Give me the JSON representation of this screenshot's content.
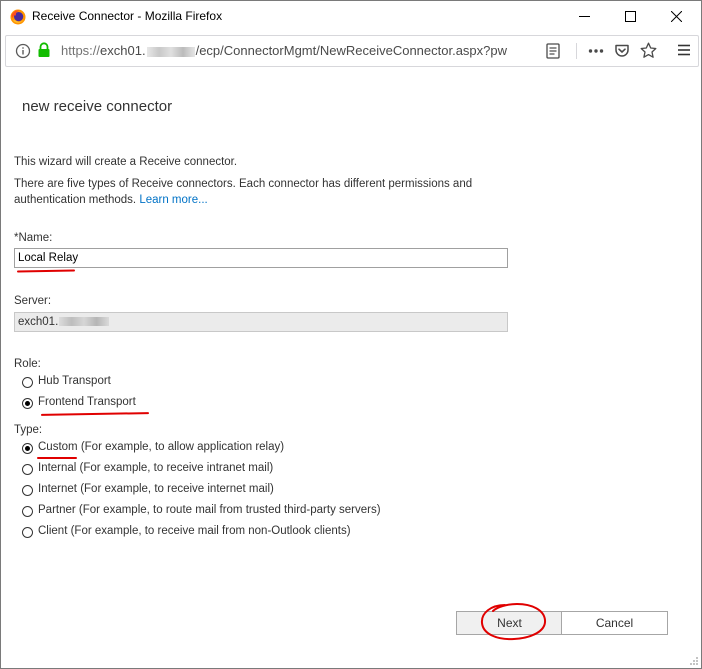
{
  "window": {
    "title": "Receive Connector - Mozilla Firefox"
  },
  "urlbar": {
    "scheme": "https://",
    "host_prefix": "exch01.",
    "path": "/ecp/ConnectorMgmt/NewReceiveConnector.aspx?pw"
  },
  "page": {
    "title": "new receive connector",
    "intro": "This wizard will create a Receive connector.",
    "description": "There are five types of Receive connectors. Each connector has different permissions and",
    "description_2": "authentication methods.",
    "learn_more": "Learn more..."
  },
  "form": {
    "name_label": "*Name:",
    "name_value": "Local Relay",
    "server_label": "Server:",
    "server_value": "exch01.",
    "role_label": "Role:",
    "roles": [
      {
        "label": "Hub Transport",
        "selected": false
      },
      {
        "label": "Frontend Transport",
        "selected": true
      }
    ],
    "type_label": "Type:",
    "types": [
      {
        "label": "Custom (For example, to allow application relay)",
        "selected": true
      },
      {
        "label": "Internal (For example, to receive intranet mail)",
        "selected": false
      },
      {
        "label": "Internet (For example, to receive internet mail)",
        "selected": false
      },
      {
        "label": "Partner (For example, to route mail from trusted third-party servers)",
        "selected": false
      },
      {
        "label": "Client (For example, to receive mail from non-Outlook clients)",
        "selected": false
      }
    ]
  },
  "buttons": {
    "next": "Next",
    "cancel": "Cancel"
  },
  "colors": {
    "link": "#0072c6",
    "annotation": "#e00000",
    "lock": "#12bc00"
  },
  "icons": [
    "firefox-logo-icon",
    "minimize-icon",
    "maximize-icon",
    "close-icon",
    "info-icon",
    "lock-icon",
    "reader-view-icon",
    "page-actions-icon",
    "pocket-icon",
    "bookmark-star-icon",
    "hamburger-menu-icon"
  ]
}
